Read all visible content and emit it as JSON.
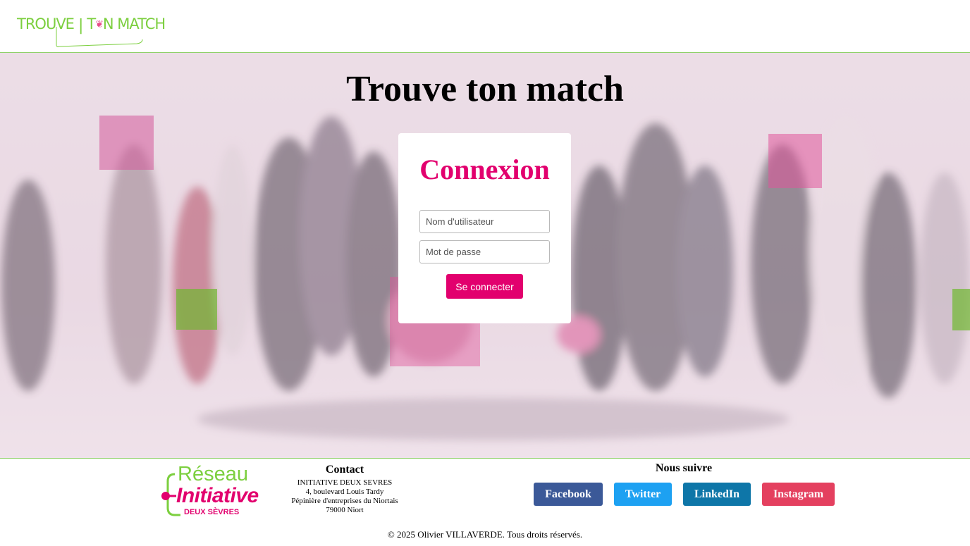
{
  "header": {
    "logo_text_left": "TROUVE",
    "logo_text_mid": "T",
    "logo_text_right": "N  MATCH"
  },
  "hero": {
    "title": "Trouve ton match"
  },
  "login": {
    "title": "Connexion",
    "username_placeholder": "Nom d'utilisateur",
    "password_placeholder": "Mot de passe",
    "submit_label": "Se connecter"
  },
  "footer": {
    "partner_logo": {
      "line1": "Réseau",
      "line2": "Initiative",
      "line3": "DEUX SÈVRES"
    },
    "contact": {
      "title": "Contact",
      "lines": [
        "INITIATIVE DEUX SEVRES",
        "4, boulevard Louis Tardy",
        "Pépinière d'entreprises du Niortais",
        "79000 Niort"
      ]
    },
    "follow": {
      "title": "Nous suivre",
      "links": [
        "Facebook",
        "Twitter",
        "LinkedIn",
        "Instagram"
      ]
    },
    "copyright": "© 2025 Olivier VILLAVERDE. Tous droits réservés."
  },
  "colors": {
    "brand_pink": "#e2006e",
    "brand_green": "#7ccf3f",
    "facebook": "#3b5998",
    "twitter": "#1da1f2",
    "linkedin": "#0e76a8",
    "instagram": "#e4405f"
  }
}
